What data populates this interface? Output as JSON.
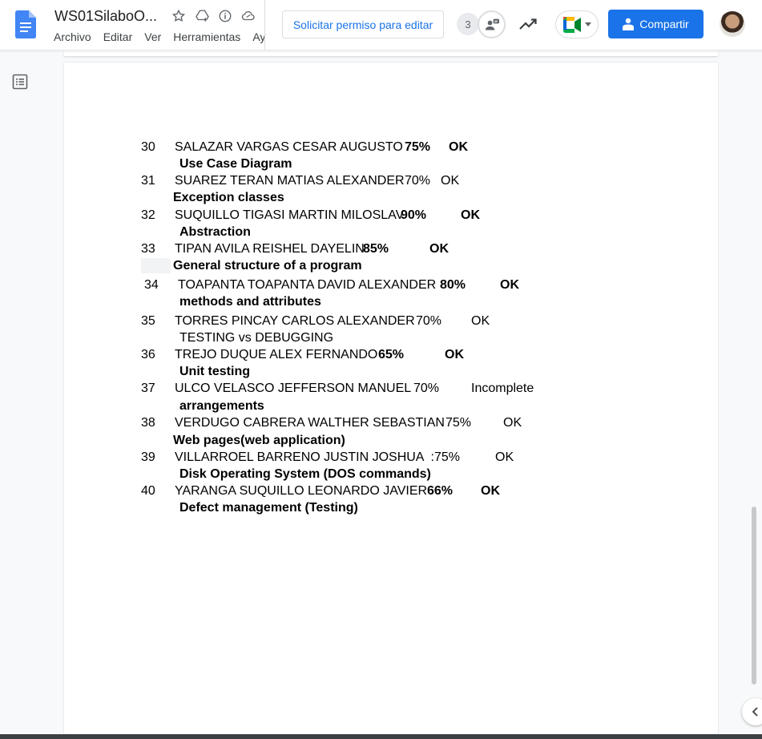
{
  "header": {
    "doc_title": "WS01SilaboO...",
    "menu": [
      "Archivo",
      "Editar",
      "Ver",
      "Herramientas",
      "Ay"
    ],
    "request_edit_label": "Solicitar permiso para editar",
    "viewer_count": "3",
    "share_label": "Compartir",
    "colors": {
      "accent": "#1a73e8",
      "doc_blue": "#4285f4"
    }
  },
  "document": {
    "rows": [
      {
        "num": "30",
        "name": "SALAZAR VARGAS CESAR AUGUSTO",
        "pct": "75%",
        "status": "OK",
        "topic": "Use Case Diagram"
      },
      {
        "num": "31",
        "name": "SUAREZ TERAN MATIAS ALEXANDER",
        "pct": "70%",
        "status": "OK",
        "topic": "Exception classes"
      },
      {
        "num": "32",
        "name": "SUQUILLO TIGASI MARTIN MILOSLAV",
        "pct": "90%",
        "status": "OK",
        "topic": "Abstraction"
      },
      {
        "num": "33",
        "name": "TIPAN AVILA REISHEL DAYELIN",
        "pct": "85%",
        "status": "OK",
        "topic": "General structure of a program"
      },
      {
        "num": "34",
        "name": "TOAPANTA TOAPANTA DAVID ALEXANDER",
        "pct": "80%",
        "status": "OK",
        "topic": "methods and attributes"
      },
      {
        "num": "35",
        "name": "TORRES PINCAY CARLOS ALEXANDER",
        "pct": "70%",
        "status": "OK",
        "topic": "TESTING vs DEBUGGING"
      },
      {
        "num": "36",
        "name": "TREJO DUQUE ALEX FERNANDO",
        "pct": "65%",
        "status": "OK",
        "topic": "Unit testing"
      },
      {
        "num": "37",
        "name": "ULCO VELASCO JEFFERSON MANUEL",
        "pct": "70%",
        "status": "Incomplete",
        "topic": "arrangements"
      },
      {
        "num": "38",
        "name": "VERDUGO CABRERA WALTHER SEBASTIAN",
        "pct": "75%",
        "status": "OK",
        "topic": "Web pages(web application)"
      },
      {
        "num": "39",
        "name": "VILLARROEL BARRENO JUSTIN JOSHUA  :",
        "pct": "75%",
        "status": "OK",
        "topic": "Disk Operating System (DOS commands)"
      },
      {
        "num": "40",
        "name": "YARANGA SUQUILLO LEONARDO JAVIER",
        "pct": "66%",
        "status": "OK",
        "topic": "Defect management (Testing)"
      }
    ]
  }
}
